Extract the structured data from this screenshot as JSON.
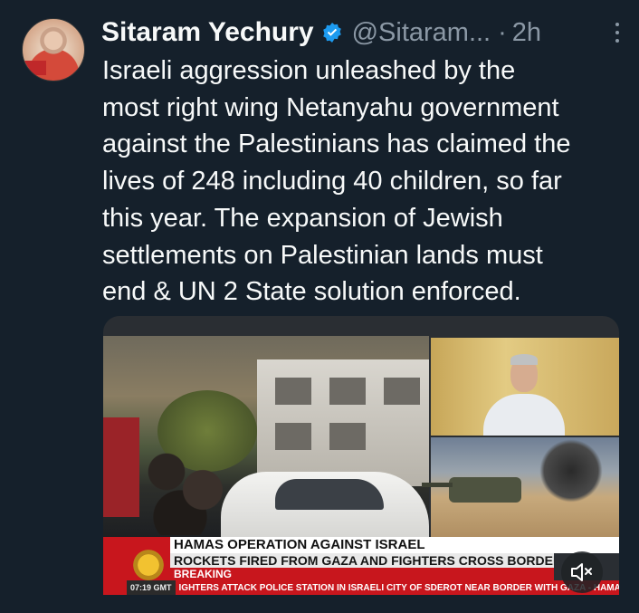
{
  "author": {
    "name": "Sitaram Yechury",
    "handle": "@Sitaram...",
    "separator": "·",
    "time": "2h",
    "verified_color": "#1d9bf0"
  },
  "tweet": {
    "text": "Israeli aggression unleashed by the\nmost right wing Netanyahu government\nagainst the Palestinians has claimed the\nlives of 248 including 40 children, so far\nthis year. The expansion of Jewish\nsettlements on Palestinian lands must\nend & UN 2 State solution enforced."
  },
  "video": {
    "headline": "HAMAS OPERATION AGAINST ISRAEL",
    "subline": "ROCKETS FIRED FROM GAZA AND FIGHTERS CROSS BORDER",
    "breaking": "BREAKING",
    "clock": "07:19 GMT",
    "crawl": "IGHTERS ATTACK POLICE STATION IN ISRAELI CITY OF SDEROT NEAR BORDER WITH GAZA  -  HAMAS CA",
    "brand_color": "#c8161d"
  },
  "controls": {
    "more_icon": "more-vertical-icon",
    "mute_icon": "speaker-muted-icon"
  }
}
